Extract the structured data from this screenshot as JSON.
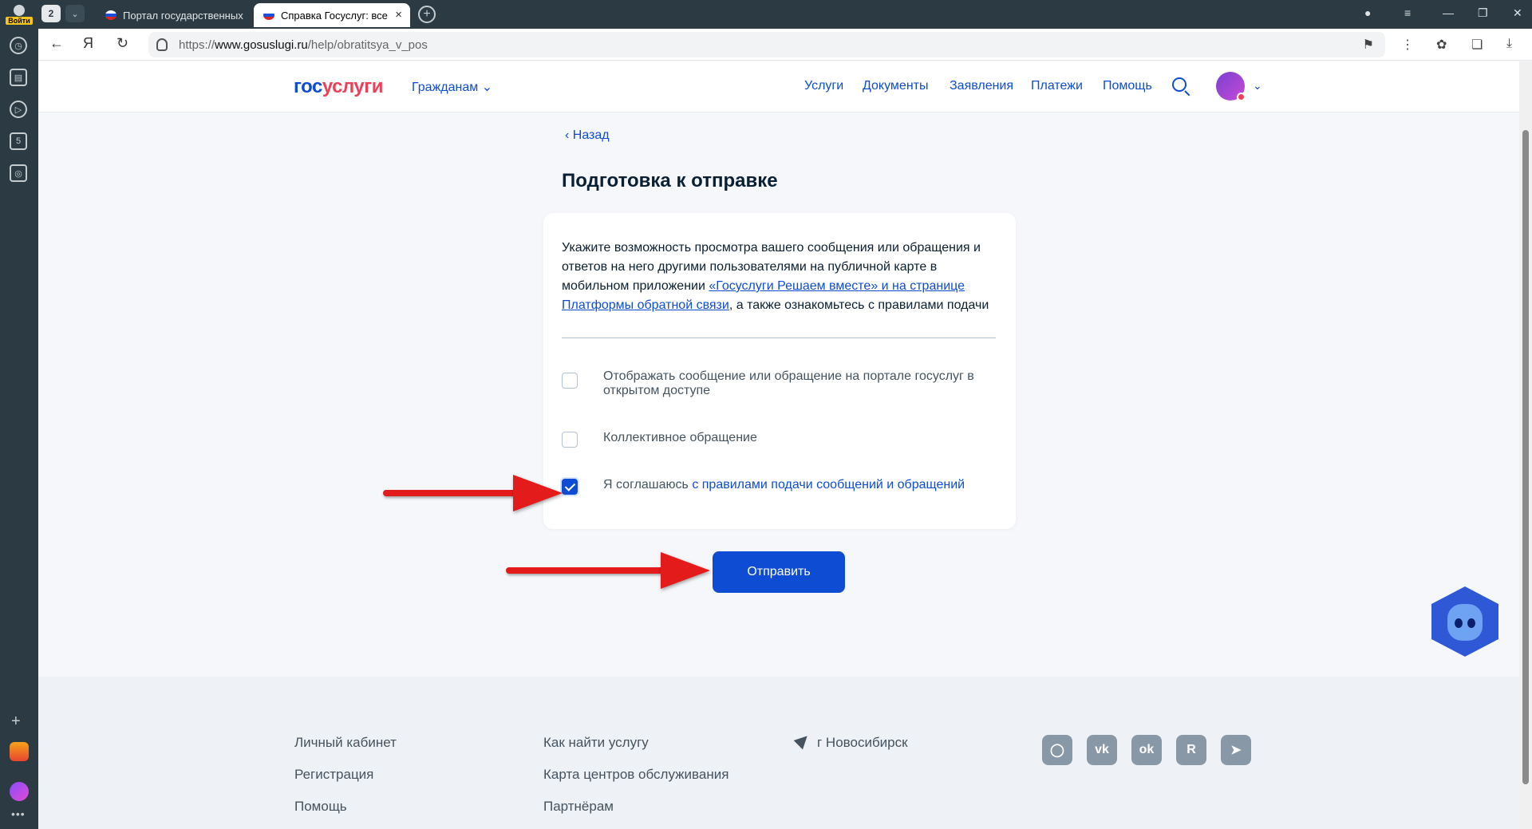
{
  "browser": {
    "login_label": "Войти",
    "tab_count": "2",
    "tabs": [
      {
        "title": "Портал государственных"
      },
      {
        "title": "Справка Госуслуг: все"
      }
    ],
    "url_scheme": "https://",
    "url_domain": "www.gosuslugi.ru",
    "url_path": "/help/obratitsya_v_pos"
  },
  "header": {
    "logo_part1": "гос",
    "logo_part2": "услуги",
    "citizens_label": "Гражданам",
    "nav": [
      "Услуги",
      "Документы",
      "Заявления",
      "Платежи",
      "Помощь"
    ]
  },
  "main": {
    "back_label": "Назад",
    "title": "Подготовка к отправке",
    "intro_text_1": "Укажите возможность просмотра вашего сообщения или обращения и ответов на него другими пользователями на публичной карте в мобильном приложении ",
    "intro_link": "«Госуслуги Решаем вместе» и на странице Платформы обратной связи",
    "intro_text_2": ", а также ознакомьтесь с правилами подачи",
    "checkboxes": [
      {
        "label": "Отображать сообщение или обращение на портале госуслуг в открытом доступе",
        "checked": false
      },
      {
        "label": "Коллективное обращение",
        "checked": false
      },
      {
        "label": "Я соглашаюсь ",
        "link": "с правилами подачи сообщений и обращений",
        "checked": true
      }
    ],
    "submit_label": "Отправить"
  },
  "footer": {
    "col1": [
      "Личный кабинет",
      "Регистрация",
      "Помощь"
    ],
    "col2": [
      "Как найти услугу",
      "Карта центров обслуживания",
      "Партнёрам"
    ],
    "location": "г Новосибирск",
    "social_icons": [
      "max-icon",
      "vk-icon",
      "ok-icon",
      "rutube-icon",
      "telegram-icon"
    ]
  },
  "colors": {
    "brand_blue": "#0d4cd3",
    "brand_red": "#ee3f58",
    "arrow_red": "#e31b1b"
  }
}
